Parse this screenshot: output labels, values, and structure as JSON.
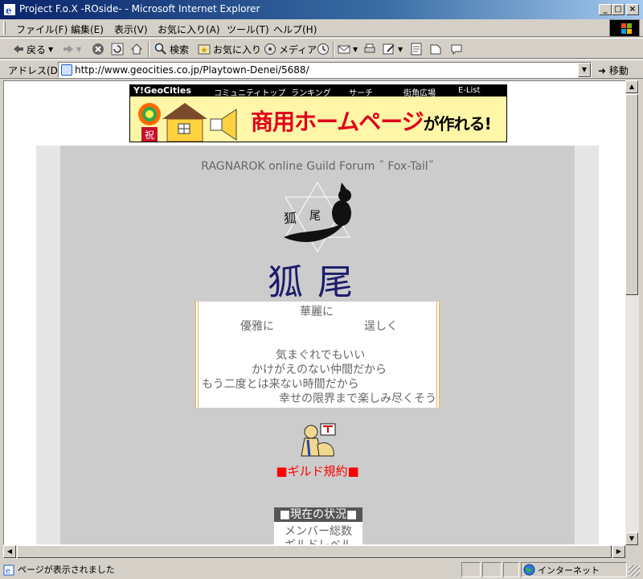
{
  "window": {
    "title": "Project F.o.X -ROside- - Microsoft Internet Explorer",
    "min_label": "_",
    "max_label": "□",
    "close_label": "×"
  },
  "menu": {
    "items": [
      "ファイル(F)",
      "編集(E)",
      "表示(V)",
      "お気に入り(A)",
      "ツール(T)",
      "ヘルプ(H)"
    ]
  },
  "toolbar": {
    "back": "戻る",
    "search": "検索",
    "favorites": "お気に入り",
    "media": "メディア"
  },
  "address": {
    "label": "アドレス(D)",
    "url": "http://www.geocities.co.jp/Playtown-Denei/5688/",
    "go": "移動"
  },
  "banner": {
    "logo": "Y!GeoCities",
    "nav": [
      "コミュニティトップ",
      "ランキング",
      "サーチ",
      "街角広場",
      "E-List"
    ],
    "headline": "商用ホームページ",
    "headline_suffix": "が作れる!",
    "badge": "祝"
  },
  "page": {
    "forum_title": "RAGNAROK online Guild Forum ˝ Fox-Tail˝",
    "logo_text": "狐",
    "logo_text2": "尾",
    "kanji_title": "狐尾",
    "poem": [
      "華麗に",
      "優雅に",
      "逞しく",
      "気まぐれでもいい",
      "かけがえのない仲間だから",
      "もう二度とは来ない時間だから",
      "幸せの限界まで楽しみ尽くそう"
    ],
    "rules_link": "■ギルド規約■",
    "status_title": "■現在の状況■",
    "status_rows": [
      "メンバー総数",
      "ギルドレベル"
    ]
  },
  "statusbar": {
    "text": "ページが表示されました",
    "zone": "インターネット"
  },
  "colors": {
    "titlebar": "#0a246a",
    "page_bg": "#cccccc",
    "kanji_title": "#1c1c6c",
    "rules_link": "#ff0000"
  }
}
